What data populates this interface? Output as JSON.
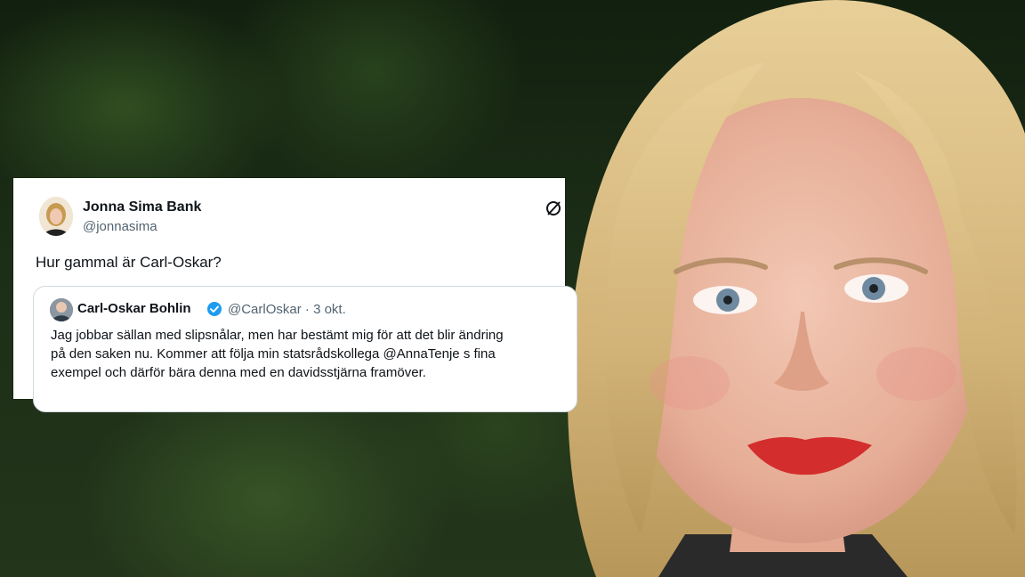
{
  "tweet": {
    "author_name": "Jonna Sima Bank",
    "author_handle": "@jonnasima",
    "text": "Hur gammal är Carl-Oskar?",
    "x_icon": "x-logo-icon",
    "quoted": {
      "author_name": "Carl-Oskar Bohlin",
      "author_handle": "@CarlOskar",
      "separator": "·",
      "date": "3 okt.",
      "verified_icon": "verified-badge-icon",
      "lines": [
        "Jag jobbar sällan med slipsnålar, men har bestämt mig för att det blir ändring",
        "på den saken nu. Kommer att följa min statsrådskollega @AnnaTenje s fina",
        "exempel och därför bära denna med en davidsstjärna framöver."
      ]
    }
  },
  "colors": {
    "text_primary": "#0f1419",
    "text_secondary": "#536471",
    "verified_blue": "#1d9bf0",
    "lip_red": "#d42d2d"
  }
}
